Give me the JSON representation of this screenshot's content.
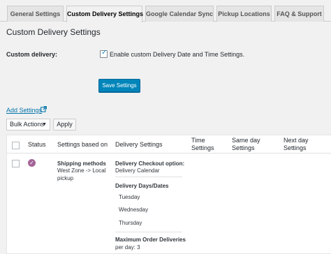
{
  "tabs": [
    {
      "label": "General Settings"
    },
    {
      "label": "Custom Delivery Settings"
    },
    {
      "label": "Google Calendar Sync"
    },
    {
      "label": "Pickup Locations"
    },
    {
      "label": "FAQ & Support"
    }
  ],
  "page_title": "Custom Delivery Settings",
  "custom_delivery": {
    "label": "Custom delivery:",
    "checkbox_label": "Enable custom Delivery Date and Time Settings.",
    "checked": true
  },
  "save_button": "Save Settings",
  "add_settings_link": "Add Settings",
  "bulk_actions": {
    "selected": "Bulk Actions",
    "apply": "Apply"
  },
  "table": {
    "headers": {
      "status": "Status",
      "based_on": "Settings based on",
      "delivery": "Delivery Settings",
      "time": [
        "Time",
        "Settings"
      ],
      "same_day": [
        "Same day",
        "Settings"
      ],
      "next_day": [
        "Next day",
        "Settings"
      ]
    },
    "row": {
      "based_on_title": "Shipping methods",
      "based_on_value": [
        "West Zone -> Local",
        "pickup"
      ],
      "checkout_option_label": "Delivery Checkout option:",
      "checkout_option_value": "Delivery Calendar",
      "days_label": "Delivery Days/Dates",
      "days": [
        "Tuesday",
        "Wednesday",
        "Thursday"
      ],
      "max_label": "Maximum Order Deliveries",
      "max_per_day_label": "per day:",
      "max_per_day_value": "3"
    }
  },
  "colors": {
    "primary_button": "#0085ba",
    "link": "#0073aa",
    "status_active": "#a46497"
  },
  "icons": {
    "external": "external-link-icon",
    "status": "check-circle-icon",
    "caret": "caret-down-icon"
  }
}
